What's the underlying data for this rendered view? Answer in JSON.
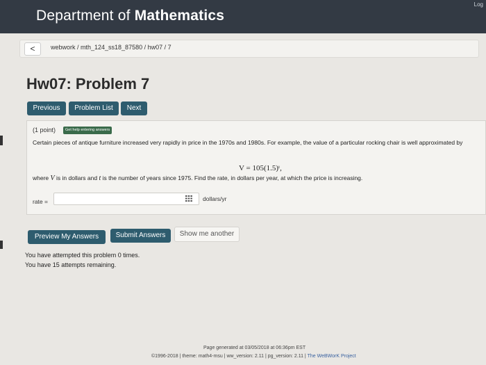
{
  "header": {
    "title_prefix": "Department of",
    "title_bold": "Mathematics",
    "login_label": "Log"
  },
  "breadcrumb": {
    "back_label": "<",
    "path": "webwork / mth_124_ss18_87580 / hw07 / 7"
  },
  "page_title": "Hw07: Problem 7",
  "nav": {
    "previous": "Previous",
    "problem_list": "Problem List",
    "next": "Next"
  },
  "problem": {
    "points": "(1 point)",
    "help_button": "Get help entering answers",
    "statement": "Certain pieces of antique furniture increased very rapidly in price in the 1970s and 1980s. For example, the value of a particular rocking chair is well approximated by",
    "equation": "V = 105(1.5)ᵗ,",
    "where_1": "where",
    "var_v": "V",
    "where_2": "is in dollars and",
    "var_t": "t",
    "where_3": "is the number of years since 1975. Find the rate, in dollars per year, at which the price is increasing.",
    "rate_label": "rate =",
    "rate_value": "",
    "units": "dollars/yr"
  },
  "actions": {
    "preview": "Preview My Answers",
    "submit": "Submit Answers",
    "show_another": "Show me another"
  },
  "attempts": {
    "line1": "You have attempted this problem 0 times.",
    "line2": "You have 15 attempts remaining."
  },
  "footer": {
    "generated": "Page generated at 03/05/2018 at 06:36pm EST",
    "copyright": "©1996-2018",
    "theme": "theme: math4-msu",
    "ww_version": "ww_version: 2.11",
    "pg_version": "pg_version: 2.11",
    "project": "The WeBWorK Project"
  },
  "colors": {
    "header_bg": "#333a44",
    "button_bg": "#2e5c6e",
    "help_bg": "#3a6b4b",
    "page_bg": "#e9e7e3"
  }
}
